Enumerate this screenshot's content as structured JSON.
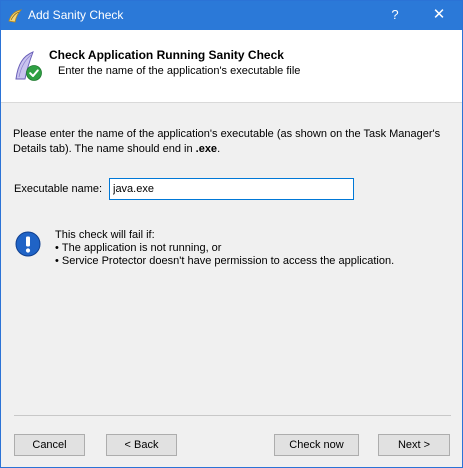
{
  "window": {
    "title": "Add Sanity Check",
    "help_glyph": "?",
    "close_glyph": "✕"
  },
  "header": {
    "title": "Check Application Running Sanity Check",
    "subtitle": "Enter the name of the application's executable file",
    "icon": "sanity-check-icon"
  },
  "intro": {
    "text": "Please enter the name of the application's executable (as shown on the Task Manager's Details tab). The name should end in ",
    "emphasis": ".exe",
    "suffix": "."
  },
  "executable": {
    "label": "Executable name:",
    "value": "java.exe"
  },
  "info": {
    "icon": "info-exclamation-icon",
    "heading": "This check will fail if:",
    "items": [
      "The application is not running, or",
      "Service Protector doesn't have permission to access the application."
    ]
  },
  "buttons": {
    "cancel": "Cancel",
    "back": "< Back",
    "check_now": "Check now",
    "next": "Next >"
  },
  "colors": {
    "titlebar": "#2b79d8",
    "window_border": "#2b73d6",
    "input_focus": "#0078d7",
    "info_blue": "#1f63c6",
    "check_green": "#2ea043"
  }
}
